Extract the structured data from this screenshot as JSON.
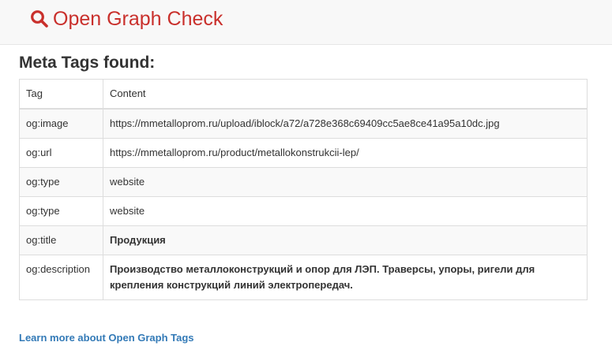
{
  "header": {
    "brand_icon": "search-icon",
    "brand_title": "Open Graph Check",
    "brand_color": "#c9302c"
  },
  "main": {
    "heading": "Meta Tags found:",
    "table": {
      "columns": [
        "Tag",
        "Content"
      ],
      "rows": [
        {
          "tag": "og:image",
          "content": "https://mmetallоprom.ru/upload/iblock/a72/a728e368c69409cc5ae8ce41a95a10dc.jpg"
        },
        {
          "tag": "og:url",
          "content": "https://mmetallоprom.ru/product/metallokonstrukcii-lep/"
        },
        {
          "tag": "og:type",
          "content": "website"
        },
        {
          "tag": "og:type",
          "content": "website"
        },
        {
          "tag": "og:title",
          "content": "Продукция"
        },
        {
          "tag": "og:description",
          "content": "Производство металлоконструкций и опор для ЛЭП. Траверсы, упоры, ригели для крепления конструкций линий электропередач."
        }
      ]
    },
    "learn_more_link": "Learn more about Open Graph Tags",
    "link_color": "#337ab7"
  }
}
